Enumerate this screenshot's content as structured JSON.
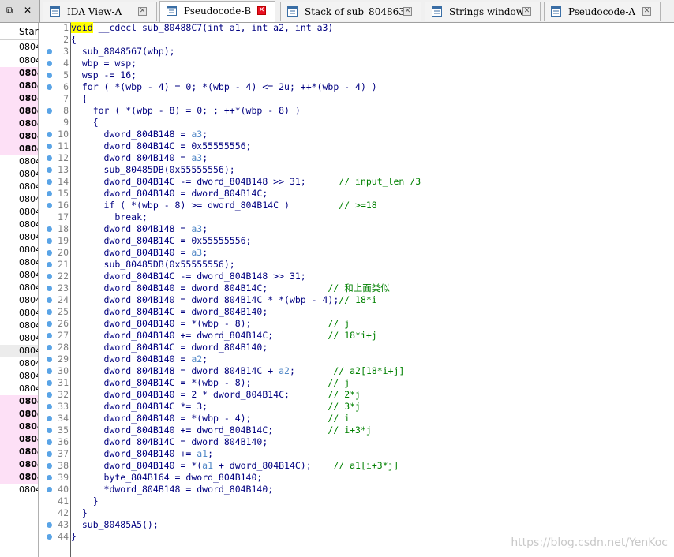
{
  "left_controls": {
    "restore": "⧉",
    "close": "✕"
  },
  "tabs": [
    {
      "label": "IDA View-A",
      "active": false,
      "icon": "ida-view-icon"
    },
    {
      "label": "Pseudocode-B",
      "active": true,
      "icon": "pseudocode-icon"
    },
    {
      "label": "Stack of sub_8048633",
      "active": false,
      "icon": "stack-icon"
    },
    {
      "label": "Strings window",
      "active": false,
      "icon": "strings-icon"
    },
    {
      "label": "Pseudocode-A",
      "active": false,
      "icon": "pseudocode-icon"
    }
  ],
  "tab_close_glyph": "✕",
  "left_panel": {
    "header": "Star",
    "rows": [
      {
        "text": "0804",
        "style": ""
      },
      {
        "text": "0804",
        "style": ""
      },
      {
        "text": "0804",
        "style": "pink"
      },
      {
        "text": "0804",
        "style": "pink"
      },
      {
        "text": "0804",
        "style": "pink"
      },
      {
        "text": "0804",
        "style": "pink"
      },
      {
        "text": "0804",
        "style": "pink"
      },
      {
        "text": "0804",
        "style": "pink"
      },
      {
        "text": "0804",
        "style": "pink"
      },
      {
        "text": "0804",
        "style": ""
      },
      {
        "text": "0804",
        "style": ""
      },
      {
        "text": "0804",
        "style": ""
      },
      {
        "text": "0804",
        "style": ""
      },
      {
        "text": "0804",
        "style": ""
      },
      {
        "text": "0804",
        "style": ""
      },
      {
        "text": "0804",
        "style": ""
      },
      {
        "text": "0804",
        "style": ""
      },
      {
        "text": "0804",
        "style": ""
      },
      {
        "text": "0804",
        "style": ""
      },
      {
        "text": "0804",
        "style": ""
      },
      {
        "text": "0804",
        "style": ""
      },
      {
        "text": "0804",
        "style": ""
      },
      {
        "text": "0804",
        "style": ""
      },
      {
        "text": "0804",
        "style": ""
      },
      {
        "text": "0804",
        "style": "gray"
      },
      {
        "text": "0804",
        "style": ""
      },
      {
        "text": "0804",
        "style": ""
      },
      {
        "text": "0804",
        "style": ""
      },
      {
        "text": "0804",
        "style": "pink"
      },
      {
        "text": "0804",
        "style": "pink"
      },
      {
        "text": "0804",
        "style": "pink"
      },
      {
        "text": "0804",
        "style": "pink"
      },
      {
        "text": "0804",
        "style": "pink"
      },
      {
        "text": "0804",
        "style": "pink"
      },
      {
        "text": "0804",
        "style": "pink"
      },
      {
        "text": "0804",
        "style": ""
      }
    ]
  },
  "code_lines": [
    {
      "n": "1",
      "dot": false,
      "segs": [
        [
          "kw",
          "void"
        ],
        [
          "t",
          " __cdecl sub_80488C7(int a1, int a2, int a3)"
        ]
      ]
    },
    {
      "n": "2",
      "dot": false,
      "segs": [
        [
          "t",
          "{"
        ]
      ]
    },
    {
      "n": "3",
      "dot": true,
      "segs": [
        [
          "t",
          "  sub_8048567(wbp);"
        ]
      ]
    },
    {
      "n": "4",
      "dot": true,
      "segs": [
        [
          "t",
          "  wbp = wsp;"
        ]
      ]
    },
    {
      "n": "5",
      "dot": true,
      "segs": [
        [
          "t",
          "  wsp -= 16;"
        ]
      ]
    },
    {
      "n": "6",
      "dot": true,
      "segs": [
        [
          "t",
          "  for ( *(wbp - 4) = 0; *(wbp - 4) <= 2u; ++*(wbp - 4) )"
        ]
      ]
    },
    {
      "n": "7",
      "dot": false,
      "segs": [
        [
          "t",
          "  {"
        ]
      ]
    },
    {
      "n": "8",
      "dot": true,
      "segs": [
        [
          "t",
          "    for ( *(wbp - 8) = 0; ; ++*(wbp - 8) )"
        ]
      ]
    },
    {
      "n": "9",
      "dot": false,
      "segs": [
        [
          "t",
          "    {"
        ]
      ]
    },
    {
      "n": "10",
      "dot": true,
      "segs": [
        [
          "t",
          "      dword_804B148 = "
        ],
        [
          "arg",
          "a3"
        ],
        [
          "t",
          ";"
        ]
      ]
    },
    {
      "n": "11",
      "dot": true,
      "segs": [
        [
          "t",
          "      dword_804B14C = 0x55555556;"
        ]
      ]
    },
    {
      "n": "12",
      "dot": true,
      "segs": [
        [
          "t",
          "      dword_804B140 = "
        ],
        [
          "arg",
          "a3"
        ],
        [
          "t",
          ";"
        ]
      ]
    },
    {
      "n": "13",
      "dot": true,
      "segs": [
        [
          "t",
          "      sub_80485DB(0x55555556);"
        ]
      ]
    },
    {
      "n": "14",
      "dot": true,
      "segs": [
        [
          "t",
          "      dword_804B14C -= dword_804B148 >> 31;      "
        ],
        [
          "cm",
          "// input_len /3"
        ]
      ]
    },
    {
      "n": "15",
      "dot": true,
      "segs": [
        [
          "t",
          "      dword_804B140 = dword_804B14C;"
        ]
      ]
    },
    {
      "n": "16",
      "dot": true,
      "segs": [
        [
          "t",
          "      if ( *(wbp - 8) >= dword_804B14C )         "
        ],
        [
          "cm",
          "// >=18"
        ]
      ]
    },
    {
      "n": "17",
      "dot": false,
      "segs": [
        [
          "t",
          "        break;"
        ]
      ]
    },
    {
      "n": "18",
      "dot": true,
      "segs": [
        [
          "t",
          "      dword_804B148 = "
        ],
        [
          "arg",
          "a3"
        ],
        [
          "t",
          ";"
        ]
      ]
    },
    {
      "n": "19",
      "dot": true,
      "segs": [
        [
          "t",
          "      dword_804B14C = 0x55555556;"
        ]
      ]
    },
    {
      "n": "20",
      "dot": true,
      "segs": [
        [
          "t",
          "      dword_804B140 = "
        ],
        [
          "arg",
          "a3"
        ],
        [
          "t",
          ";"
        ]
      ]
    },
    {
      "n": "21",
      "dot": true,
      "segs": [
        [
          "t",
          "      sub_80485DB(0x55555556);"
        ]
      ]
    },
    {
      "n": "22",
      "dot": true,
      "segs": [
        [
          "t",
          "      dword_804B14C -= dword_804B148 >> 31;"
        ]
      ]
    },
    {
      "n": "23",
      "dot": true,
      "segs": [
        [
          "t",
          "      dword_804B140 = dword_804B14C;           "
        ],
        [
          "cm",
          "// 和上面类似"
        ]
      ]
    },
    {
      "n": "24",
      "dot": true,
      "segs": [
        [
          "t",
          "      dword_804B140 = dword_804B14C * *(wbp - 4);"
        ],
        [
          "cm",
          "// 18*i"
        ]
      ]
    },
    {
      "n": "25",
      "dot": true,
      "segs": [
        [
          "t",
          "      dword_804B14C = dword_804B140;"
        ]
      ]
    },
    {
      "n": "26",
      "dot": true,
      "segs": [
        [
          "t",
          "      dword_804B140 = *(wbp - 8);              "
        ],
        [
          "cm",
          "// j"
        ]
      ]
    },
    {
      "n": "27",
      "dot": true,
      "segs": [
        [
          "t",
          "      dword_804B140 += dword_804B14C;          "
        ],
        [
          "cm",
          "// 18*i+j"
        ]
      ]
    },
    {
      "n": "28",
      "dot": true,
      "segs": [
        [
          "t",
          "      dword_804B14C = dword_804B140;"
        ]
      ]
    },
    {
      "n": "29",
      "dot": true,
      "segs": [
        [
          "t",
          "      dword_804B140 = "
        ],
        [
          "arg",
          "a2"
        ],
        [
          "t",
          ";"
        ]
      ]
    },
    {
      "n": "30",
      "dot": true,
      "segs": [
        [
          "t",
          "      dword_804B148 = dword_804B14C + "
        ],
        [
          "arg",
          "a2"
        ],
        [
          "t",
          ";       "
        ],
        [
          "cm",
          "// a2[18*i+j]"
        ]
      ]
    },
    {
      "n": "31",
      "dot": true,
      "segs": [
        [
          "t",
          "      dword_804B14C = *(wbp - 8);              "
        ],
        [
          "cm",
          "// j"
        ]
      ]
    },
    {
      "n": "32",
      "dot": true,
      "segs": [
        [
          "t",
          "      dword_804B140 = 2 * dword_804B14C;       "
        ],
        [
          "cm",
          "// 2*j"
        ]
      ]
    },
    {
      "n": "33",
      "dot": true,
      "segs": [
        [
          "t",
          "      dword_804B14C *= 3;                      "
        ],
        [
          "cm",
          "// 3*j"
        ]
      ]
    },
    {
      "n": "34",
      "dot": true,
      "segs": [
        [
          "t",
          "      dword_804B140 = *(wbp - 4);              "
        ],
        [
          "cm",
          "// i"
        ]
      ]
    },
    {
      "n": "35",
      "dot": true,
      "segs": [
        [
          "t",
          "      dword_804B140 += dword_804B14C;          "
        ],
        [
          "cm",
          "// i+3*j"
        ]
      ]
    },
    {
      "n": "36",
      "dot": true,
      "segs": [
        [
          "t",
          "      dword_804B14C = dword_804B140;"
        ]
      ]
    },
    {
      "n": "37",
      "dot": true,
      "segs": [
        [
          "t",
          "      dword_804B140 += "
        ],
        [
          "arg",
          "a1"
        ],
        [
          "t",
          ";"
        ]
      ]
    },
    {
      "n": "38",
      "dot": true,
      "segs": [
        [
          "t",
          "      dword_804B140 = *("
        ],
        [
          "arg",
          "a1"
        ],
        [
          "t",
          " + dword_804B14C);    "
        ],
        [
          "cm",
          "// a1[i+3*j]"
        ]
      ]
    },
    {
      "n": "39",
      "dot": true,
      "segs": [
        [
          "t",
          "      byte_804B164 = dword_804B140;"
        ]
      ]
    },
    {
      "n": "40",
      "dot": true,
      "segs": [
        [
          "t",
          "      *dword_804B148 = dword_804B140;"
        ]
      ]
    },
    {
      "n": "41",
      "dot": false,
      "segs": [
        [
          "t",
          "    }"
        ]
      ]
    },
    {
      "n": "42",
      "dot": false,
      "segs": [
        [
          "t",
          "  }"
        ]
      ]
    },
    {
      "n": "43",
      "dot": true,
      "segs": [
        [
          "t",
          "  sub_80485A5();"
        ]
      ]
    },
    {
      "n": "44",
      "dot": true,
      "segs": [
        [
          "t",
          "}"
        ]
      ]
    }
  ],
  "watermark": "https://blog.csdn.net/YenKoc",
  "colors": {
    "keyword_highlight": "#ffff00",
    "code_text": "#000080",
    "argument": "#4f86c6",
    "comment": "#008000",
    "breakpoint_dot": "#5aa4e6",
    "left_pink": "#fde0f6",
    "active_tab_close": "#e81123"
  }
}
